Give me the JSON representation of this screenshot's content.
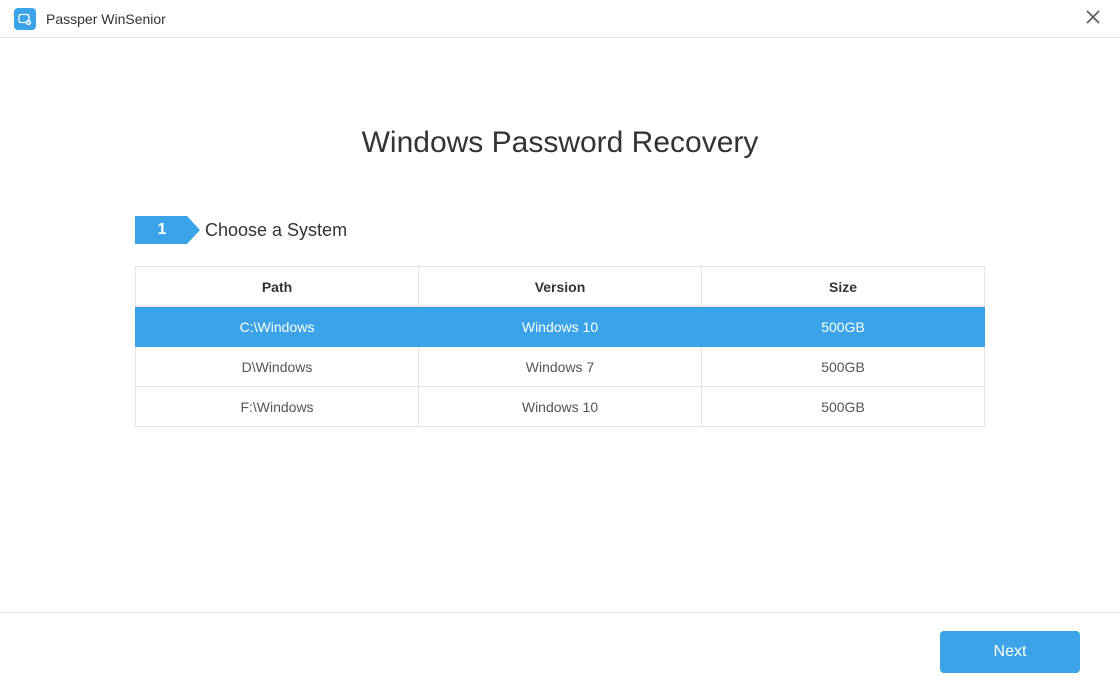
{
  "app": {
    "title": "Passper WinSenior"
  },
  "page": {
    "heading": "Windows Password Recovery"
  },
  "step": {
    "number": "1",
    "label": "Choose a System"
  },
  "table": {
    "headers": {
      "path": "Path",
      "version": "Version",
      "size": "Size"
    },
    "rows": [
      {
        "path": "C:\\Windows",
        "version": "Windows 10",
        "size": "500GB",
        "selected": true
      },
      {
        "path": "D\\Windows",
        "version": "Windows 7",
        "size": "500GB",
        "selected": false
      },
      {
        "path": "F:\\Windows",
        "version": "Windows 10",
        "size": "500GB",
        "selected": false
      }
    ]
  },
  "footer": {
    "next_label": "Next"
  },
  "colors": {
    "accent": "#3ba3e8"
  }
}
